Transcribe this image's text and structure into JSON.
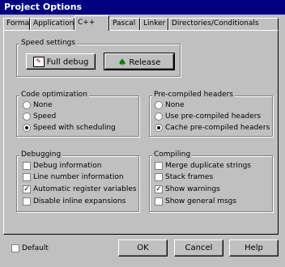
{
  "window": {
    "title": "Project Options"
  },
  "tabs": [
    "Format",
    "Application",
    "C++",
    "Pascal",
    "Linker",
    "Directories/Conditionals"
  ],
  "speed_settings": {
    "title": "Speed settings",
    "full_debug": "Full debug",
    "release": "Release"
  },
  "code_optimization": {
    "title": "Code optimization",
    "options": [
      "None",
      "Speed",
      "Speed with scheduling"
    ],
    "selected": "Speed with scheduling"
  },
  "precompiled_headers": {
    "title": "Pre-compiled headers",
    "options": [
      "None",
      "Use pre-compiled headers",
      "Cache pre-compiled headers"
    ],
    "selected": "Cache pre-compiled headers"
  },
  "debugging": {
    "title": "Debugging",
    "options": [
      "Debug information",
      "Line number information",
      "Automatic register variables",
      "Disable inline expansions"
    ],
    "checked": [
      false,
      false,
      true,
      false
    ]
  },
  "compiling": {
    "title": "Compiling",
    "options": [
      "Merge duplicate strings",
      "Stack frames",
      "Show warnings",
      "Show general msgs"
    ],
    "checked": [
      false,
      false,
      true,
      false
    ]
  },
  "footer": {
    "default_label": "Default",
    "default_checked": false,
    "ok": "OK",
    "cancel": "Cancel",
    "help": "Help"
  }
}
